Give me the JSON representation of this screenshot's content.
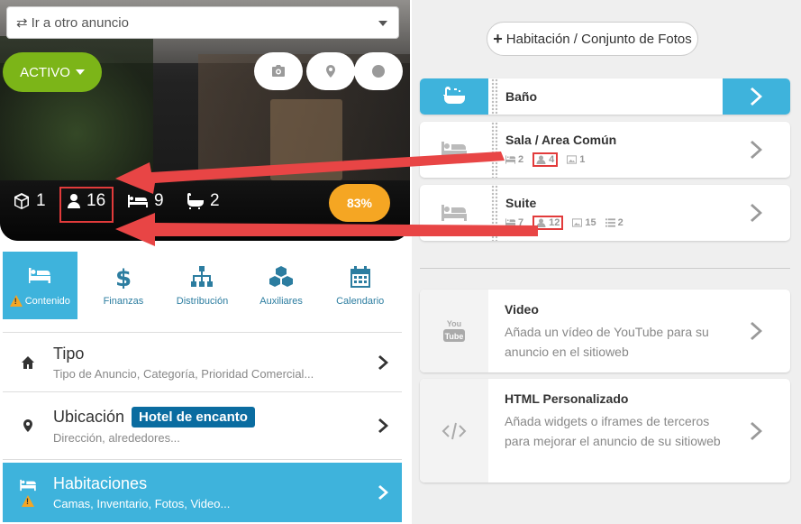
{
  "ad_selector": {
    "label": "Ir a otro anuncio"
  },
  "status": {
    "label": "ACTIVO"
  },
  "stats": {
    "units": "1",
    "guests": "16",
    "beds": "9",
    "baths": "2"
  },
  "progress": {
    "label": "83%",
    "value": 0.83
  },
  "tabs": [
    {
      "label": "Contenido"
    },
    {
      "label": "Finanzas"
    },
    {
      "label": "Distribución"
    },
    {
      "label": "Auxiliares"
    },
    {
      "label": "Calendario"
    }
  ],
  "rows": {
    "tipo": {
      "title": "Tipo",
      "subtitle": "Tipo de Anuncio, Categoría, Prioridad Comercial..."
    },
    "ubicacion": {
      "title": "Ubicación",
      "badge": "Hotel de encanto",
      "subtitle": "Dirección, alrededores..."
    },
    "habitaciones": {
      "title": "Habitaciones",
      "subtitle": "Camas, Inventario, Fotos, Video..."
    }
  },
  "right": {
    "add_button": "Habitación / Conjunto de Fotos",
    "rooms": [
      {
        "name": "Baño"
      },
      {
        "name": "Sala / Area Común",
        "beds": "2",
        "guests": "4",
        "photos": "1"
      },
      {
        "name": "Suite",
        "beds": "7",
        "guests": "12",
        "photos": "15",
        "items": "2"
      }
    ],
    "video": {
      "title": "Video",
      "description": "Añada un vídeo de YouTube para su anuncio en el sitioweb"
    },
    "html": {
      "title": "HTML Personalizado",
      "description": "Añada widgets o iframes de terceros para mejorar el anuncio de su sitioweb"
    },
    "youtube_logo": {
      "line1": "You",
      "line2": "Tube"
    }
  },
  "colors": {
    "accent": "#3eb3dc",
    "active_green": "#7cb518",
    "progress_orange": "#f5a623",
    "badge_blue": "#0a6ca0",
    "highlight_red": "#e23b3b"
  }
}
